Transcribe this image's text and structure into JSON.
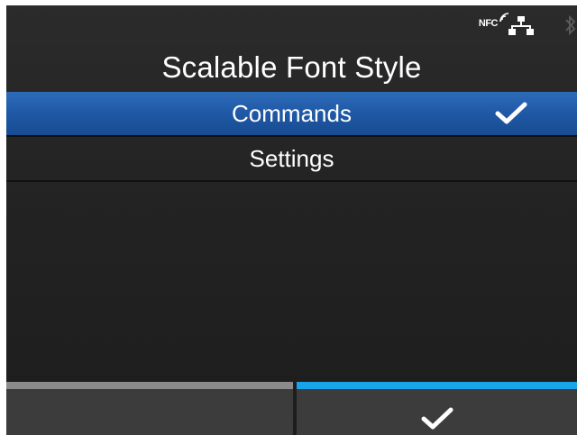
{
  "status": {
    "nfc_label": "NFC",
    "icons": [
      "nfc-icon",
      "network-icon",
      "bluetooth-icon"
    ]
  },
  "title": "Scalable Font Style",
  "menu": {
    "items": [
      {
        "label": "Commands",
        "selected": true
      },
      {
        "label": "Settings",
        "selected": false
      }
    ]
  },
  "footer": {
    "left_button": {
      "icon": "none"
    },
    "right_button": {
      "icon": "check-icon"
    }
  },
  "colors": {
    "selected_row": "#1e57a3",
    "confirm_accent": "#19a4ea",
    "inactive_accent": "#8b8b8b"
  }
}
